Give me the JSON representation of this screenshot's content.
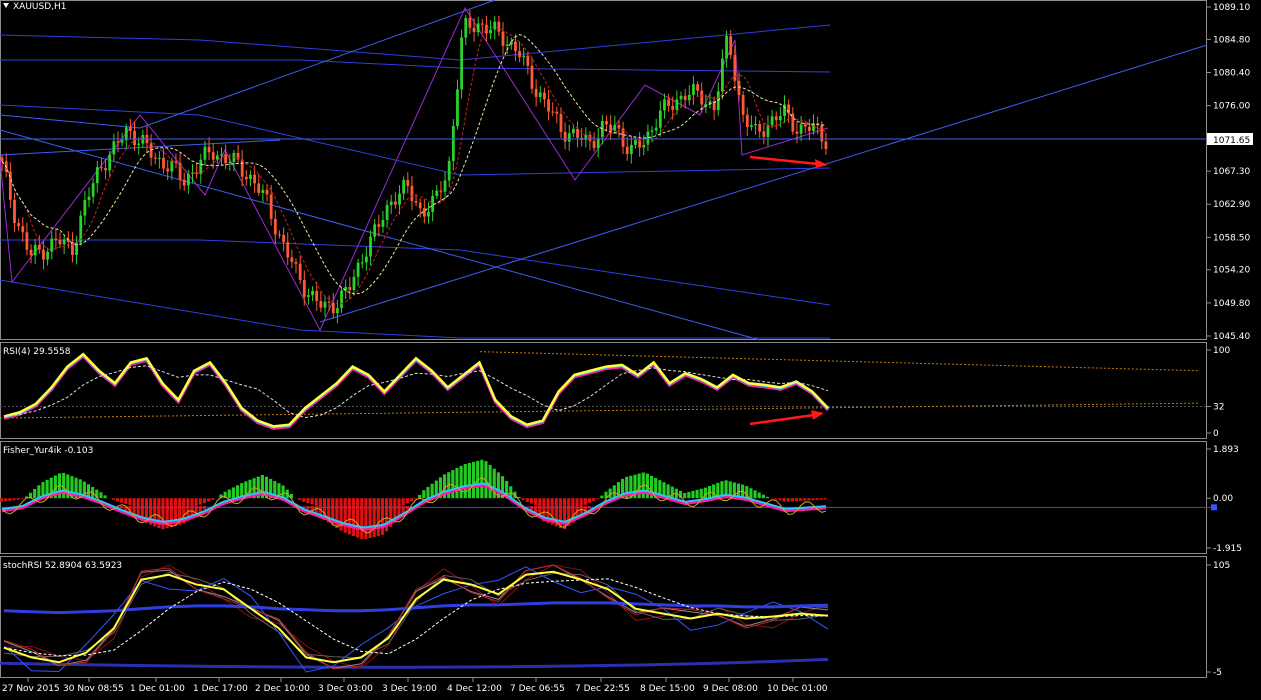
{
  "chart_data": [
    {
      "type": "candlestick",
      "title": "XAUUSD,H1",
      "ylim": [
        1045.4,
        1089.1
      ],
      "y_ticks": [
        "1089.10",
        "1084.80",
        "1080.40",
        "1076.00",
        "1071.65",
        "1067.30",
        "1062.90",
        "1058.50",
        "1054.20",
        "1049.80",
        "1045.40"
      ],
      "current_price": "1071.65",
      "x_ticks": [
        "27 Nov 2015",
        "30 Nov 08:55",
        "1 Dec 01:00",
        "1 Dec 17:00",
        "2 Dec 10:00",
        "3 Dec 03:00",
        "3 Dec 19:00",
        "4 Dec 12:00",
        "7 Dec 06:55",
        "7 Dec 22:55",
        "8 Dec 15:00",
        "9 Dec 08:00",
        "10 Dec 01:00"
      ],
      "close_path": [
        1068,
        1061,
        1056,
        1057,
        1058,
        1057,
        1063,
        1068,
        1070,
        1073,
        1071,
        1069,
        1068,
        1066,
        1068,
        1070,
        1069,
        1068,
        1066,
        1063,
        1058,
        1054,
        1051,
        1049,
        1050,
        1052,
        1057,
        1060,
        1064,
        1065,
        1062,
        1063,
        1068,
        1086,
        1087,
        1086,
        1085,
        1083,
        1079,
        1076,
        1073,
        1072,
        1071,
        1073,
        1073,
        1070,
        1071,
        1075,
        1076,
        1078,
        1077,
        1076,
        1085,
        1075,
        1072,
        1074,
        1075,
        1073,
        1073,
        1071.6
      ],
      "colors": {
        "up": "#2bd22b",
        "down": "#ff5a36",
        "channel": "#2f3fe0",
        "trendline": "#3a5ff0",
        "zigzag": "#9a2bd6"
      }
    },
    {
      "type": "line",
      "title": "RSI(4) 29.5558",
      "ylim": [
        0,
        100
      ],
      "y_ticks": [
        "100",
        "32",
        "0"
      ],
      "series": [
        {
          "name": "RSI(4)",
          "color": "#ffff40",
          "values": [
            20,
            25,
            35,
            55,
            80,
            95,
            75,
            60,
            85,
            90,
            60,
            40,
            75,
            85,
            60,
            30,
            15,
            8,
            10,
            30,
            45,
            60,
            80,
            70,
            50,
            70,
            90,
            75,
            55,
            70,
            85,
            40,
            20,
            10,
            15,
            50,
            70,
            75,
            80,
            82,
            70,
            85,
            60,
            72,
            65,
            55,
            70,
            60,
            58,
            55,
            62,
            50,
            30
          ]
        }
      ]
    },
    {
      "type": "bar",
      "title": "Fisher_Yur4ik -0.103",
      "ylim": [
        -1.915,
        1.893
      ],
      "y_ticks": [
        "1.893",
        "0.00",
        "-1.915"
      ],
      "series": [
        {
          "name": "Fisher_Yur4ik",
          "values": [
            -0.3,
            -0.1,
            0.6,
            1.0,
            0.7,
            0.2,
            -0.4,
            -0.9,
            -1.2,
            -1.0,
            -0.5,
            0.2,
            0.6,
            0.9,
            0.5,
            -0.3,
            -0.8,
            -1.3,
            -1.6,
            -1.4,
            -0.6,
            0.3,
            0.9,
            1.3,
            1.5,
            0.8,
            -0.2,
            -0.9,
            -1.2,
            -0.6,
            0.2,
            0.8,
            1.0,
            0.6,
            0.2,
            0.4,
            0.7,
            0.5,
            0.1,
            -0.3,
            -0.2,
            -0.103
          ]
        }
      ]
    },
    {
      "type": "line",
      "title": "stochRSI 52.8904 63.5923",
      "ylim": [
        -5,
        105
      ],
      "y_ticks": [
        "105",
        "-5"
      ],
      "series": [
        {
          "name": "stochRSI main",
          "color": "#ffff40",
          "values": [
            20,
            10,
            5,
            15,
            40,
            90,
            95,
            85,
            80,
            60,
            40,
            10,
            5,
            10,
            30,
            70,
            90,
            85,
            75,
            95,
            98,
            90,
            80,
            60,
            55,
            50,
            55,
            50,
            52,
            55,
            52.89
          ]
        },
        {
          "name": "stochRSI signal",
          "color": "#2f3fe0",
          "values": [
            58,
            57,
            56,
            57,
            58,
            60,
            62,
            63,
            63,
            62,
            60,
            59,
            58,
            58,
            59,
            61,
            63,
            64,
            64,
            65,
            66,
            66,
            66,
            65,
            64,
            63,
            63,
            62,
            62,
            63,
            63.59
          ]
        }
      ]
    }
  ]
}
